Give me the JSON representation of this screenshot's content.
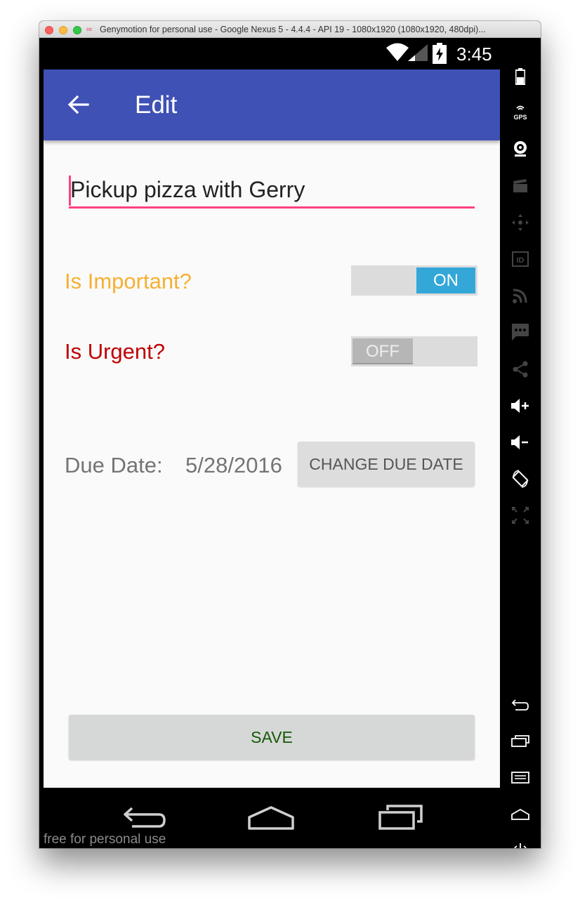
{
  "window": {
    "title": "Genymotion for personal use - Google Nexus 5 - 4.4.4 - API 19 - 1080x1920 (1080x1920, 480dpi)..."
  },
  "statusbar": {
    "time": "3:45",
    "icons": [
      "wifi-icon",
      "signal-icon",
      "battery-charging-icon"
    ]
  },
  "appbar": {
    "title": "Edit",
    "back_icon": "arrow-left-icon"
  },
  "form": {
    "task_value": "Pickup pizza with Gerry",
    "important_label": "Is Important?",
    "important_state": "ON",
    "urgent_label": "Is Urgent?",
    "urgent_state": "OFF",
    "due_label": "Due Date:",
    "due_value": "5/28/2016",
    "change_due_label": "CHANGE DUE DATE",
    "save_label": "SAVE"
  },
  "navbar": {
    "watermark": "free for personal use",
    "icons": [
      "nav-back-icon",
      "nav-home-icon",
      "nav-recents-icon"
    ]
  },
  "sidepanel": {
    "gps_label": "GPS",
    "id_label": "ID",
    "icons": [
      "battery-icon",
      "gps-icon",
      "webcam-icon",
      "capture-icon",
      "dpad-icon",
      "identifiers-icon",
      "rss-icon",
      "sms-icon",
      "share-icon",
      "volume-up-icon",
      "volume-down-icon",
      "rotate-icon",
      "pixel-perfect-icon",
      "back-icon",
      "recent-apps-icon",
      "menu-icon",
      "home-icon",
      "power-icon"
    ]
  },
  "colors": {
    "appbar": "#3f51b5",
    "accent": "#ff4081",
    "important_label": "#f6b033",
    "urgent_label": "#c00000",
    "toggle_on": "#33a7d8",
    "save_text": "#155a06"
  }
}
